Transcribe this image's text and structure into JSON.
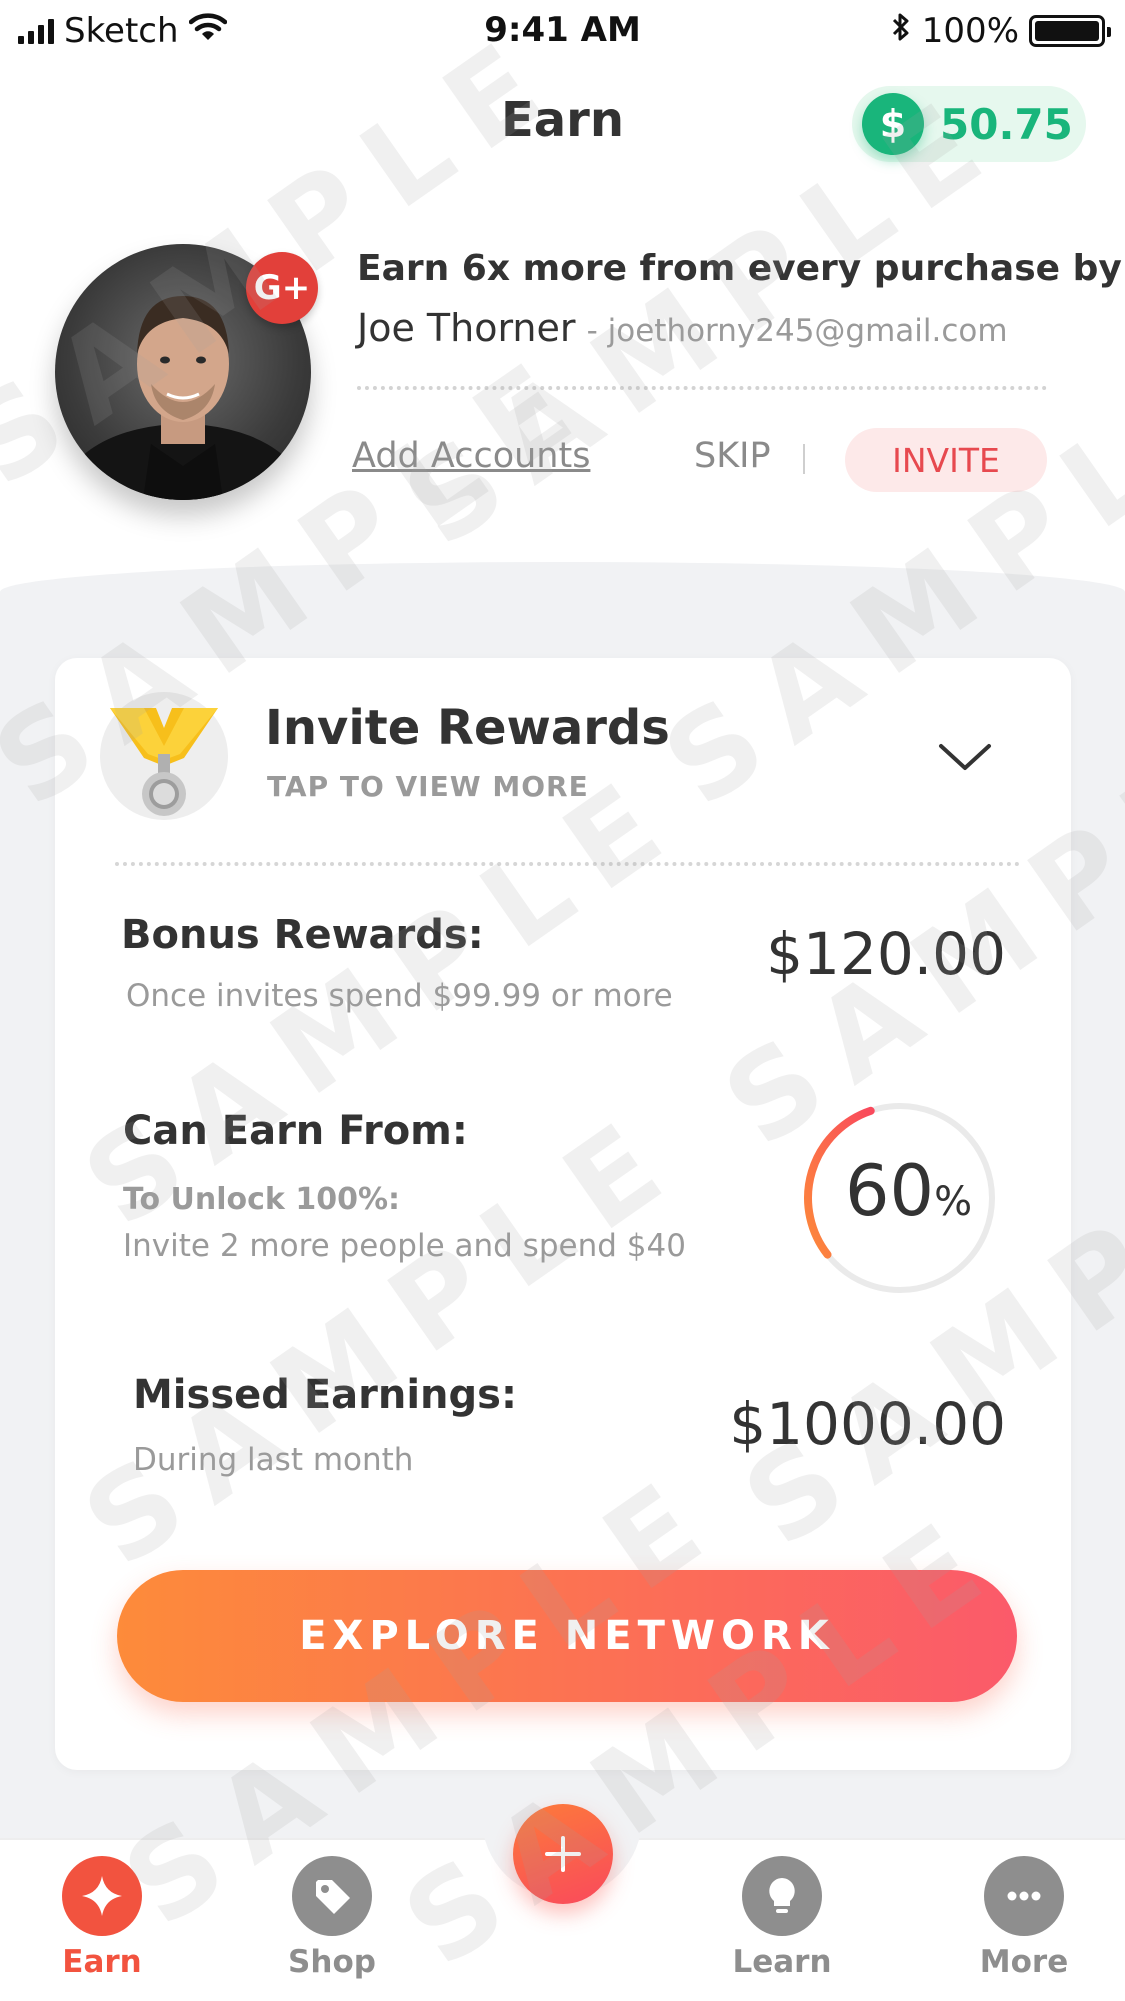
{
  "status_bar": {
    "carrier": "Sketch",
    "time": "9:41 AM",
    "battery": "100%",
    "battery_level": 1.0
  },
  "header": {
    "title": "Earn",
    "balance_symbol": "$",
    "balance": "50.75"
  },
  "profile": {
    "badge": "G+",
    "headline": "Earn 6x more from every purchase by:",
    "name": "Joe Thorner",
    "email": "- joethorny245@gmail.com",
    "add_accounts": "Add Accounts",
    "skip": "SKIP",
    "invite": "INVITE"
  },
  "card": {
    "title": "Invite Rewards",
    "subtitle": "TAP TO VIEW MORE",
    "rows": {
      "bonus": {
        "label": "Bonus Rewards:",
        "sub": "Once invites spend $99.99 or more",
        "value": "$120.00"
      },
      "can_earn": {
        "label": "Can Earn From:",
        "sub_bold": "To Unlock 100%:",
        "sub": "Invite 2 more people and spend $40",
        "percent": "60",
        "unit": "%"
      },
      "missed": {
        "label": "Missed Earnings:",
        "sub": "During last month",
        "value": "$1000.00"
      }
    },
    "cta": "EXPLORE NETWORK"
  },
  "tab_bar": {
    "items": [
      {
        "label": "Earn",
        "icon": "sparkle-icon",
        "active": true
      },
      {
        "label": "Shop",
        "icon": "tag-icon",
        "active": false
      },
      {
        "label": "Learn",
        "icon": "lightbulb-icon",
        "active": false
      },
      {
        "label": "More",
        "icon": "more-dots-icon",
        "active": false
      }
    ],
    "fab_icon": "plus-icon"
  },
  "watermark": "SAMPLE",
  "colors": {
    "accent_green": "#19b57b",
    "accent_red": "#e7494f",
    "cta_gradient_start": "#fd8b3a",
    "cta_gradient_end": "#fb5a6a",
    "active_tab": "#f2533f"
  }
}
